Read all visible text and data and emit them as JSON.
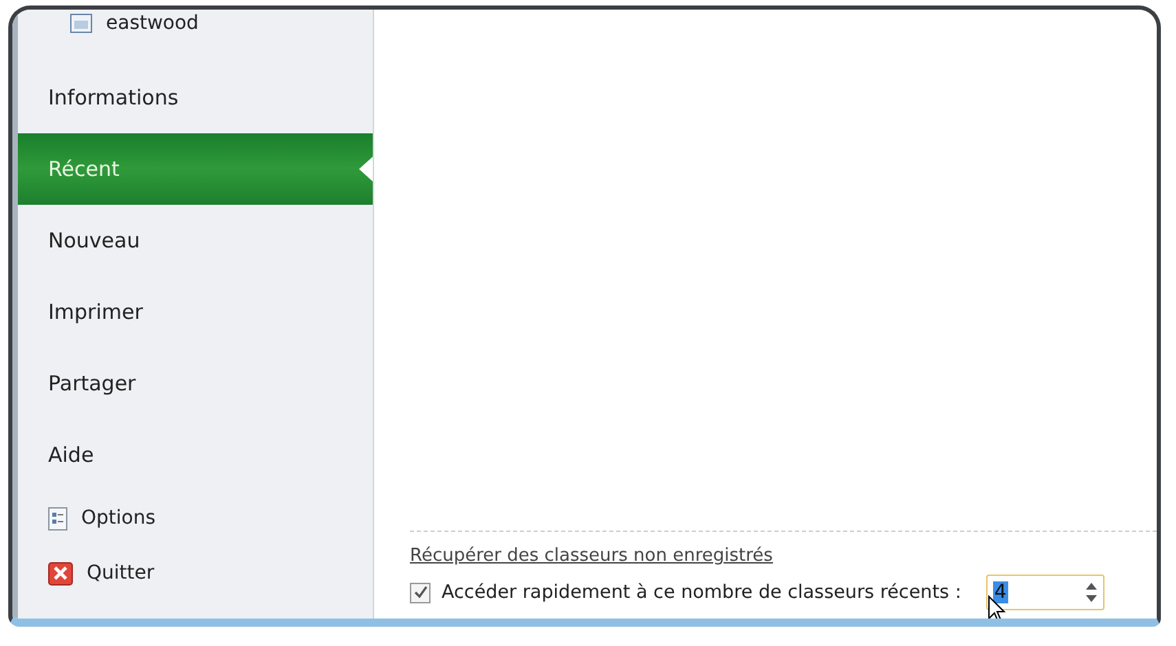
{
  "recent_file": {
    "name": "eastwood"
  },
  "menu": [
    {
      "label": "Informations",
      "kind": "text",
      "selected": false
    },
    {
      "label": "Récent",
      "kind": "text",
      "selected": true
    },
    {
      "label": "Nouveau",
      "kind": "text",
      "selected": false
    },
    {
      "label": "Imprimer",
      "kind": "text",
      "selected": false
    },
    {
      "label": "Partager",
      "kind": "text",
      "selected": false
    },
    {
      "label": "Aide",
      "kind": "text",
      "selected": false
    },
    {
      "label": "Options",
      "kind": "options",
      "selected": false
    },
    {
      "label": "Quitter",
      "kind": "exit",
      "selected": false
    }
  ],
  "recover_link": "Récupérer des classeurs non enregistrés",
  "quick_access": {
    "label": "Accéder rapidement à ce nombre de classeurs récents :",
    "checked": true,
    "value": "4"
  }
}
